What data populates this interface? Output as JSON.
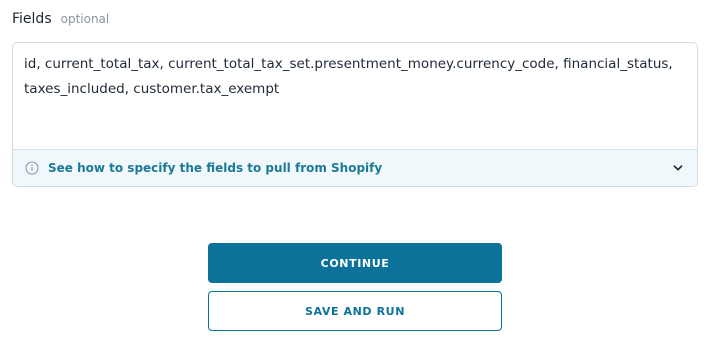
{
  "field": {
    "label": "Fields",
    "hint": "optional",
    "value": "id, current_total_tax, current_total_tax_set.presentment_money.currency_code, financial_status, taxes_included, customer.tax_exempt",
    "help_text": "See how to specify the fields to pull from Shopify"
  },
  "icons": {
    "info": "info-circle-icon",
    "expand": "chevron-down-icon"
  },
  "actions": {
    "continue_label": "CONTINUE",
    "save_and_run_label": "SAVE AND RUN"
  },
  "colors": {
    "primary": "#0c729a",
    "help_text": "#1c7a96",
    "help_background": "#f1f8fb",
    "border": "#d3dae2"
  }
}
